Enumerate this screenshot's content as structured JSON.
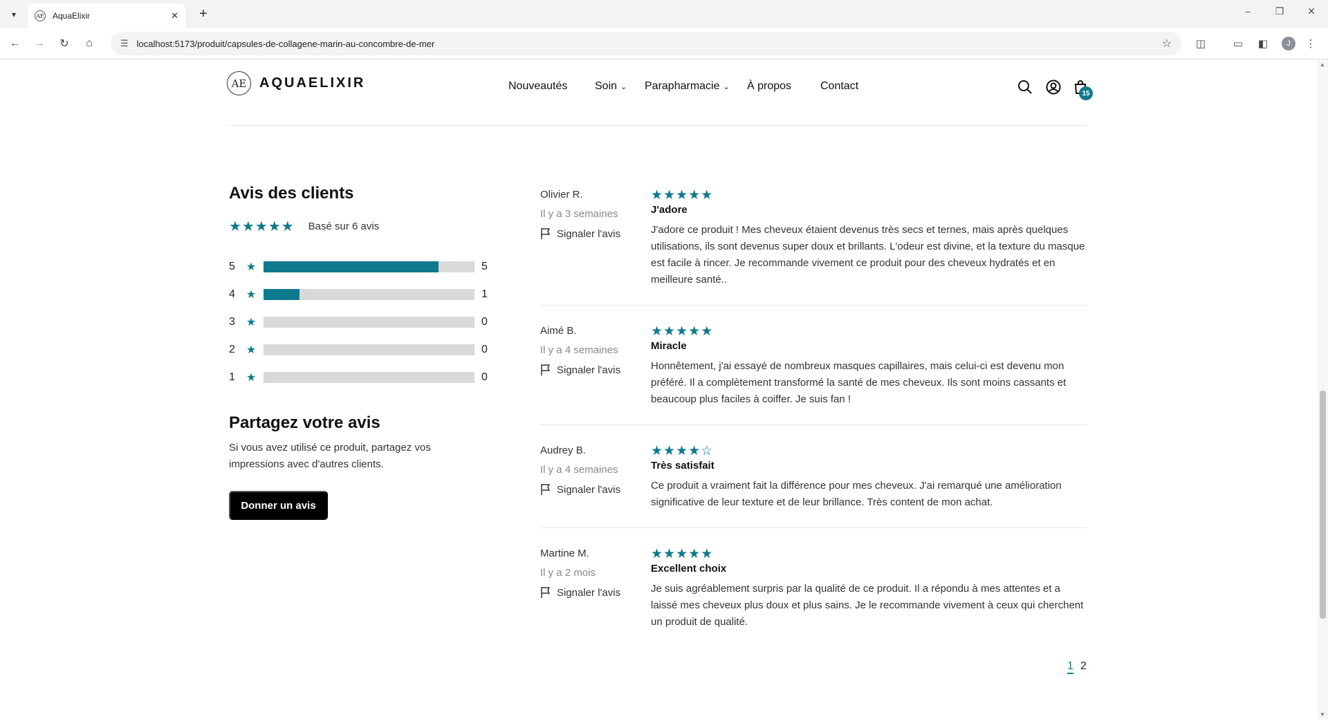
{
  "browser": {
    "tab_title": "AquaElixir",
    "url": "localhost:5173/produit/capsules-de-collagene-marin-au-concombre-de-mer",
    "profile_initial": "J"
  },
  "header": {
    "logo_text": "AQUAELIXIR",
    "logo_mark": "AE",
    "nav": {
      "nouveautes": "Nouveautés",
      "soin": "Soin",
      "parapharmacie": "Parapharmacie",
      "apropos": "À propos",
      "contact": "Contact"
    },
    "cart_count": "15"
  },
  "reviews": {
    "title": "Avis des clients",
    "average_stars": "★★★★★",
    "based_on": "Basé sur 6 avis",
    "distribution": [
      {
        "stars": "5",
        "count": "5",
        "fraction": 0.83
      },
      {
        "stars": "4",
        "count": "1",
        "fraction": 0.17
      },
      {
        "stars": "3",
        "count": "0",
        "fraction": 0
      },
      {
        "stars": "2",
        "count": "0",
        "fraction": 0
      },
      {
        "stars": "1",
        "count": "0",
        "fraction": 0
      }
    ],
    "share_title": "Partagez votre avis",
    "share_text": "Si vous avez utilisé ce produit, partagez vos impressions avec d'autres clients.",
    "cta_label": "Donner un avis",
    "report_label": "Signaler l'avis",
    "list": [
      {
        "author": "Olivier R.",
        "date": "Il y a 3 semaines",
        "rating": 5,
        "title": "J'adore",
        "body": "J'adore ce produit ! Mes cheveux étaient devenus très secs et ternes, mais après quelques utilisations, ils sont devenus super doux et brillants. L'odeur est divine, et la texture du masque est facile à rincer. Je recommande vivement ce produit pour des cheveux hydratés et en meilleure santé.."
      },
      {
        "author": "Aimé B.",
        "date": "Il y a 4 semaines",
        "rating": 5,
        "title": "Miracle",
        "body": "Honnêtement, j'ai essayé de nombreux masques capillaires, mais celui-ci est devenu mon préféré. Il a complètement transformé la santé de mes cheveux. Ils sont moins cassants et beaucoup plus faciles à coiffer. Je suis fan !"
      },
      {
        "author": "Audrey B.",
        "date": "Il y a 4 semaines",
        "rating": 4,
        "title": "Très satisfait",
        "body": "Ce produit a vraiment fait la différence pour mes cheveux. J'ai remarqué une amélioration significative de leur texture et de leur brillance. Très content de mon achat."
      },
      {
        "author": "Martine M.",
        "date": "Il y a 2 mois",
        "rating": 5,
        "title": "Excellent choix",
        "body": "Je suis agréablement surpris par la qualité de ce produit. Il a répondu à mes attentes et a laissé mes cheveux plus doux et plus sains. Je le recommande vivement à ceux qui cherchent un produit de qualité."
      }
    ],
    "pages": [
      "1",
      "2"
    ]
  },
  "colors": {
    "accent": "#0e7a8e",
    "bar_empty": "#d9d9d9",
    "button": "#000000"
  }
}
